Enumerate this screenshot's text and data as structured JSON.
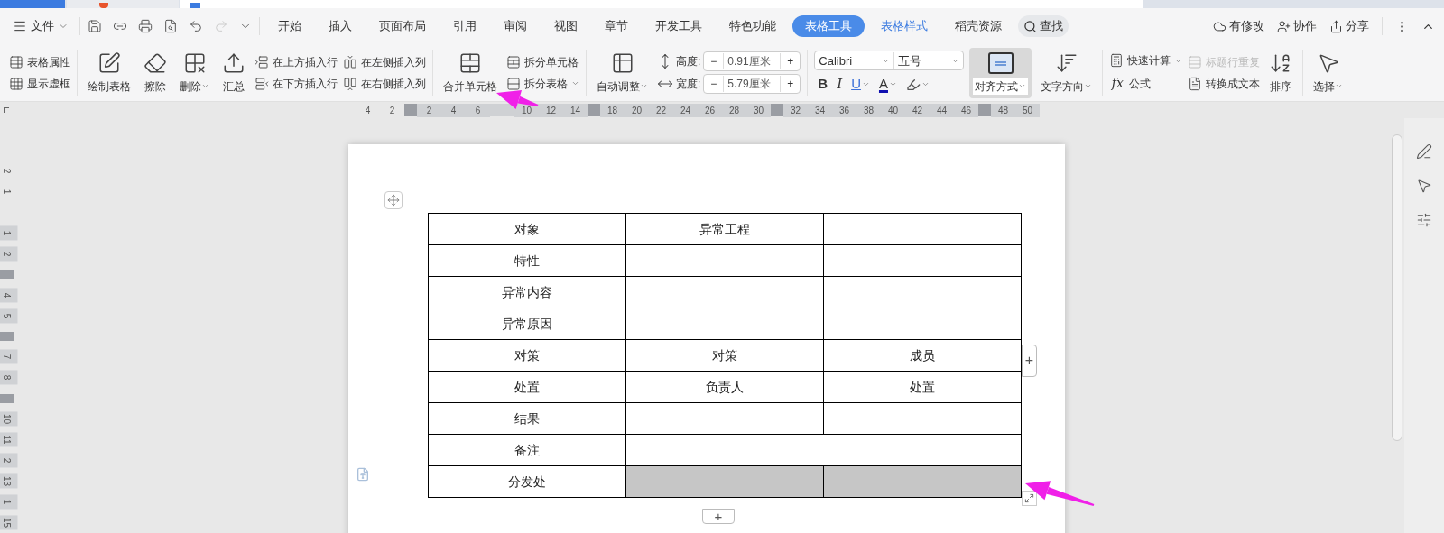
{
  "menu_bar": {
    "file_menu": "文件",
    "tabs": [
      {
        "label": "开始",
        "selected": false,
        "contextual": false
      },
      {
        "label": "插入",
        "selected": false,
        "contextual": false
      },
      {
        "label": "页面布局",
        "selected": false,
        "contextual": false
      },
      {
        "label": "引用",
        "selected": false,
        "contextual": false
      },
      {
        "label": "审阅",
        "selected": false,
        "contextual": false
      },
      {
        "label": "视图",
        "selected": false,
        "contextual": false
      },
      {
        "label": "章节",
        "selected": false,
        "contextual": false
      },
      {
        "label": "开发工具",
        "selected": false,
        "contextual": false
      },
      {
        "label": "特色功能",
        "selected": false,
        "contextual": false
      },
      {
        "label": "表格工具",
        "selected": true,
        "contextual": true
      },
      {
        "label": "表格样式",
        "selected": false,
        "contextual": true
      },
      {
        "label": "稻壳资源",
        "selected": false,
        "contextual": false
      }
    ],
    "search": "查找",
    "actions": [
      "有修改",
      "协作",
      "分享"
    ]
  },
  "ribbon": {
    "groups": [
      {
        "columns": [
          {
            "kind": "stack",
            "items": [
              {
                "label": "表格属性",
                "dropdown": false,
                "disabled": false
              },
              {
                "label": "显示虚框",
                "dropdown": false,
                "disabled": false
              }
            ]
          }
        ]
      },
      {
        "columns": [
          {
            "kind": "large",
            "label": "绘制表格",
            "dropdown": false,
            "selected": false
          },
          {
            "kind": "large",
            "label": "擦除",
            "dropdown": false,
            "selected": false
          },
          {
            "kind": "large",
            "label": "删除",
            "dropdown": true,
            "selected": false
          },
          {
            "kind": "large",
            "label": "汇总",
            "dropdown": false,
            "selected": false
          },
          {
            "kind": "stack",
            "items": [
              {
                "label": "在上方插入行",
                "dropdown": false,
                "disabled": false
              },
              {
                "label": "在下方插入行",
                "dropdown": false,
                "disabled": false
              }
            ]
          },
          {
            "kind": "stack",
            "items": [
              {
                "label": "在左侧插入列",
                "dropdown": false,
                "disabled": false
              },
              {
                "label": "在右侧插入列",
                "dropdown": false,
                "disabled": false
              }
            ]
          }
        ]
      },
      {
        "columns": [
          {
            "kind": "large",
            "label": "合并单元格",
            "dropdown": false,
            "selected": false
          },
          {
            "kind": "stack",
            "items": [
              {
                "label": "拆分单元格",
                "dropdown": false,
                "disabled": false
              },
              {
                "label": "拆分表格",
                "dropdown": true,
                "disabled": false
              }
            ]
          }
        ]
      },
      {
        "columns": [
          {
            "kind": "large",
            "label": "自动调整",
            "dropdown": true,
            "selected": false
          },
          {
            "kind": "spinners",
            "items": [
              {
                "label": "高度:",
                "value": "0.91厘米",
                "minus": "−",
                "plus": "+"
              },
              {
                "label": "宽度:",
                "value": "5.79厘米",
                "minus": "−",
                "plus": "+"
              }
            ]
          }
        ]
      },
      {
        "columns": [
          {
            "kind": "font",
            "font": "Calibri",
            "size": "五号",
            "buttons": [
              {
                "glyph": "B",
                "dropdown": false
              },
              {
                "glyph": "I",
                "dropdown": false
              },
              {
                "glyph": "U",
                "dropdown": true
              },
              {
                "glyph": "A",
                "dropdown": true
              }
            ],
            "highlight_dropdown": true
          },
          {
            "kind": "large",
            "label": "对齐方式",
            "dropdown": true,
            "selected": true
          },
          {
            "kind": "large",
            "label": "文字方向",
            "dropdown": true,
            "selected": false
          }
        ]
      },
      {
        "columns": [
          {
            "kind": "stack",
            "items": [
              {
                "label": "快速计算",
                "dropdown": true,
                "disabled": false
              },
              {
                "label": "公式",
                "glyph": "fx",
                "dropdown": false,
                "disabled": false
              }
            ]
          },
          {
            "kind": "stack",
            "items": [
              {
                "label": "标题行重复",
                "dropdown": false,
                "disabled": true
              },
              {
                "label": "转换成文本",
                "dropdown": false,
                "disabled": false
              }
            ]
          },
          {
            "kind": "large",
            "label": "排序",
            "dropdown": false,
            "selected": false
          }
        ]
      },
      {
        "columns": [
          {
            "kind": "large",
            "label": "选择",
            "dropdown": true,
            "selected": false
          }
        ]
      }
    ]
  },
  "ruler": {
    "horizontal": [
      {
        "kind": "number",
        "text": "4"
      },
      {
        "kind": "number",
        "text": "2"
      },
      {
        "kind": "marker"
      },
      {
        "kind": "number",
        "text": "2"
      },
      {
        "kind": "number",
        "text": "4"
      },
      {
        "kind": "number",
        "text": "6"
      },
      {
        "kind": "blank"
      },
      {
        "kind": "number",
        "text": "10"
      },
      {
        "kind": "number",
        "text": "12"
      },
      {
        "kind": "number",
        "text": "14"
      },
      {
        "kind": "marker"
      },
      {
        "kind": "number",
        "text": "18"
      },
      {
        "kind": "number",
        "text": "20"
      },
      {
        "kind": "number",
        "text": "22"
      },
      {
        "kind": "number",
        "text": "24"
      },
      {
        "kind": "number",
        "text": "26"
      },
      {
        "kind": "number",
        "text": "28"
      },
      {
        "kind": "number",
        "text": "30"
      },
      {
        "kind": "marker"
      },
      {
        "kind": "number",
        "text": "32"
      },
      {
        "kind": "number",
        "text": "34"
      },
      {
        "kind": "number",
        "text": "36"
      },
      {
        "kind": "number",
        "text": "38"
      },
      {
        "kind": "number",
        "text": "40"
      },
      {
        "kind": "number",
        "text": "42"
      },
      {
        "kind": "number",
        "text": "44"
      },
      {
        "kind": "number",
        "text": "46"
      },
      {
        "kind": "marker"
      },
      {
        "kind": "number",
        "text": "48"
      },
      {
        "kind": "number",
        "text": "50"
      }
    ],
    "vertical": [
      {
        "kind": "number",
        "text": "2"
      },
      {
        "kind": "number",
        "text": "1"
      },
      {
        "kind": "blank"
      },
      {
        "kind": "number",
        "text": "1"
      },
      {
        "kind": "number",
        "text": "2"
      },
      {
        "kind": "marker"
      },
      {
        "kind": "number",
        "text": "4"
      },
      {
        "kind": "number",
        "text": "5"
      },
      {
        "kind": "marker"
      },
      {
        "kind": "number",
        "text": "7"
      },
      {
        "kind": "number",
        "text": "8"
      },
      {
        "kind": "marker"
      },
      {
        "kind": "number",
        "text": "10"
      },
      {
        "kind": "number",
        "text": "11"
      },
      {
        "kind": "number",
        "text": "2"
      },
      {
        "kind": "number",
        "text": "13"
      },
      {
        "kind": "number",
        "text": "1"
      },
      {
        "kind": "number",
        "text": "15"
      }
    ]
  },
  "table": {
    "add_glyph": "+",
    "rows": [
      {
        "cells": [
          {
            "text": "对象",
            "selected": false
          },
          {
            "text": "异常工程",
            "selected": false
          },
          {
            "text": "",
            "selected": false
          }
        ]
      },
      {
        "cells": [
          {
            "text": "特性",
            "selected": false
          },
          {
            "text": "",
            "selected": false
          },
          {
            "text": "",
            "selected": false
          }
        ]
      },
      {
        "cells": [
          {
            "text": "异常内容",
            "selected": false
          },
          {
            "text": "",
            "selected": false
          },
          {
            "text": "",
            "selected": false
          }
        ]
      },
      {
        "cells": [
          {
            "text": "异常原因",
            "selected": false
          },
          {
            "text": "",
            "selected": false
          },
          {
            "text": "",
            "selected": false
          }
        ]
      },
      {
        "cells": [
          {
            "text": "对策",
            "selected": false
          },
          {
            "text": "对策",
            "selected": false
          },
          {
            "text": "成员",
            "selected": false
          }
        ]
      },
      {
        "cells": [
          {
            "text": "处置",
            "selected": false
          },
          {
            "text": "负责人",
            "selected": false
          },
          {
            "text": "处置",
            "selected": false
          }
        ]
      },
      {
        "cells": [
          {
            "text": "结果",
            "selected": false
          },
          {
            "text": "",
            "selected": false
          },
          {
            "text": "",
            "selected": false
          }
        ]
      },
      {
        "cells": [
          {
            "text": "备注",
            "selected": false
          },
          {
            "text": "",
            "selected": false
          }
        ]
      },
      {
        "cells": [
          {
            "text": "分发处",
            "selected": false
          },
          {
            "text": "",
            "selected": true
          },
          {
            "text": "",
            "selected": true
          }
        ]
      }
    ]
  }
}
